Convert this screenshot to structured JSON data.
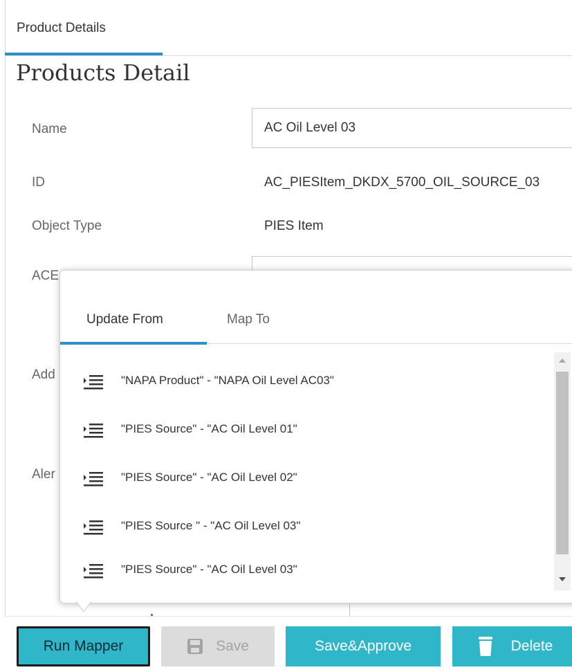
{
  "tab": {
    "label": "Product Details"
  },
  "page": {
    "title": "Products Detail"
  },
  "fields": {
    "name_label": "Name",
    "name_value": "AC Oil Level 03",
    "id_label": "ID",
    "id_value": "AC_PIESItem_DKDX_5700_OIL_SOURCE_03",
    "type_label": "Object Type",
    "type_value": "PIES Item",
    "partial_label_1": "ACE",
    "partial_label_2": "Add",
    "partial_label_3": "Aler"
  },
  "popup": {
    "tabs": [
      {
        "label": "Update From",
        "active": true
      },
      {
        "label": "Map To",
        "active": false
      }
    ],
    "items": [
      {
        "label": "\"NAPA Product\" - \"NAPA Oil Level AC03\"",
        "icon": "indent-list-icon"
      },
      {
        "label": "\"PIES Source\" - \"AC Oil Level 01\"",
        "icon": "indent-list-icon"
      },
      {
        "label": "\"PIES Source\" - \"AC Oil Level 02\"",
        "icon": "indent-list-icon"
      },
      {
        "label": "\"PIES Source \" - \"AC Oil Level 03\"",
        "icon": "indent-list-icon"
      },
      {
        "label": "\"PIES Source\" - \"AC Oil Level 03\"",
        "icon": "indent-list-icon"
      }
    ]
  },
  "buttons": {
    "run_mapper": "Run Mapper",
    "save": "Save",
    "save_approve": "Save&Approve",
    "delete": "Delete"
  },
  "colors": {
    "accent": "#2d8fc9",
    "button_teal": "#2fb7c9",
    "disabled_bg": "#dcdcdc"
  }
}
